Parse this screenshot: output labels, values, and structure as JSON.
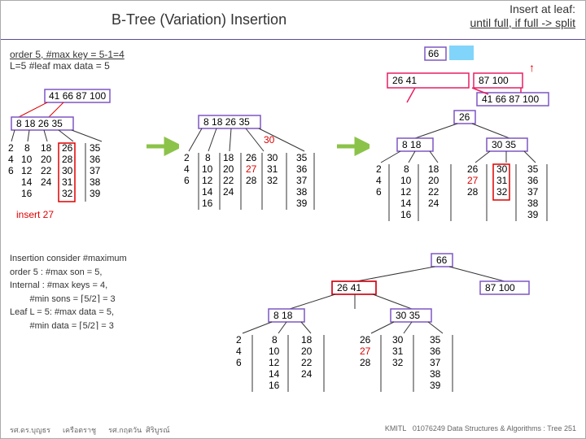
{
  "title": "B-Tree (Variation) Insertion",
  "split_leaf": "Insert at leaf:",
  "split_rule": "until full, if full -> split",
  "order_text": "order 5, #max key = 5-1=4",
  "leaf_text": "L=5 #leaf max data = 5",
  "insert_label": "insert 27",
  "tree1": {
    "root": [
      "41",
      "66",
      "87",
      "100"
    ],
    "sub": [
      "8",
      "18",
      "26",
      "35"
    ],
    "l0": [
      "2",
      "4",
      "6"
    ],
    "l1": [
      "8",
      "10",
      "12",
      "14",
      "16"
    ],
    "l2": [
      "18",
      "20",
      "22",
      "24"
    ],
    "l3": [
      "26",
      "28",
      "30",
      "31",
      "32"
    ],
    "l4": [
      "35",
      "36",
      "37",
      "38",
      "39"
    ]
  },
  "tree2": {
    "sub": [
      "8",
      "18",
      "26",
      "35"
    ],
    "l0": [
      "2",
      "4",
      "6"
    ],
    "l1": [
      "8",
      "10",
      "12",
      "14",
      "16"
    ],
    "l2": [
      "18",
      "20",
      "22",
      "24"
    ],
    "l3_split": "30",
    "l3a": [
      "26",
      "27",
      "28"
    ],
    "l3b": [
      "30",
      "31",
      "32"
    ],
    "l4": [
      "35",
      "36",
      "37",
      "38",
      "39"
    ]
  },
  "top_right": {
    "a": [
      "66"
    ],
    "b": [
      "26",
      "41",
      "87",
      "100"
    ],
    "c": [
      "41",
      "66",
      "87",
      "100"
    ]
  },
  "tree3": {
    "n26": "26",
    "l1": [
      "8",
      "18"
    ],
    "l2": [
      "30",
      "35"
    ],
    "ll0": [
      "2",
      "4",
      "6"
    ],
    "ll1": [
      "8",
      "10",
      "12",
      "14",
      "16"
    ],
    "ll2": [
      "18",
      "20",
      "22",
      "24"
    ],
    "lr0": [
      "26",
      "27",
      "28"
    ],
    "lr1": [
      "30",
      "31",
      "32"
    ],
    "lr2": [
      "35",
      "36",
      "37",
      "38",
      "39"
    ]
  },
  "tree4": {
    "n66": "66",
    "l1": [
      "26",
      "41"
    ],
    "l2": [
      "87",
      "100"
    ],
    "sub": [
      "8",
      "18"
    ],
    "sub2": [
      "30",
      "35"
    ],
    "ll0": [
      "2",
      "4",
      "6"
    ],
    "ll1": [
      "8",
      "10",
      "12",
      "14",
      "16"
    ],
    "ll2": [
      "18",
      "20",
      "22",
      "24"
    ],
    "lr0": [
      "26",
      "27",
      "28"
    ],
    "lr1": [
      "30",
      "31",
      "32"
    ],
    "lr2": [
      "35",
      "36",
      "37",
      "38",
      "39"
    ]
  },
  "notes": {
    "t1": "Insertion consider #maximum",
    "t2": "order 5 : #max son = 5,",
    "t3": "Internal : #max keys = 4,",
    "t4_a": "#min sons = ",
    "t4_b": "5/2",
    "t4_c": " = 3",
    "t5": "Leaf L = 5: #max data = 5,",
    "t6_a": "#min data = ",
    "t6_b": "5/2",
    "t6_c": " = 3"
  },
  "footer": {
    "left_a": "รศ.ดร.บุญธร",
    "left_b": "เครือตราชู",
    "mid_a": "รศ.กฤตวัน",
    "mid_b": "ศิริบูรณ์",
    "inst": "KMITL",
    "course": "01076249 Data Structures & Algorithms : Tree 251"
  }
}
